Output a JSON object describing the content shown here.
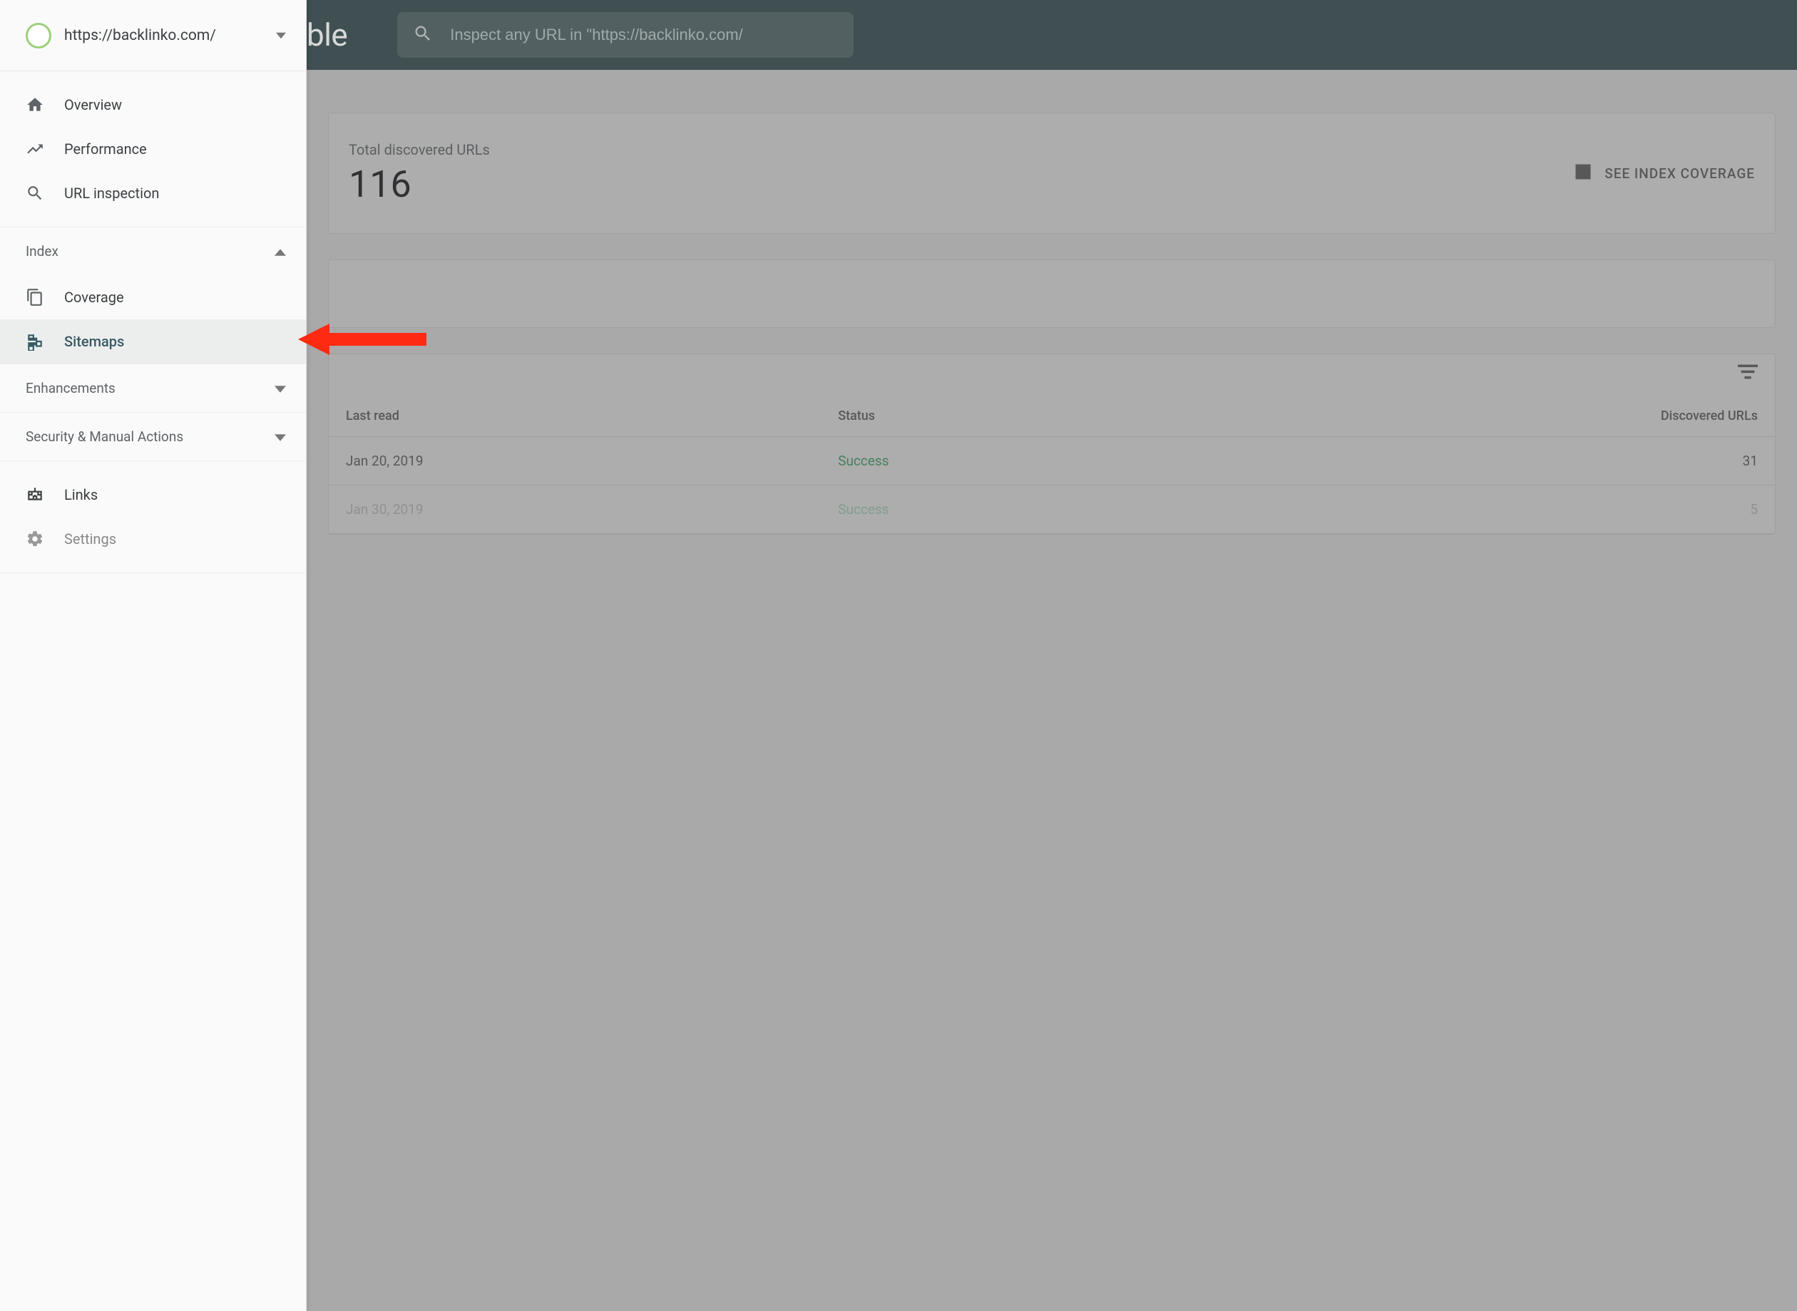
{
  "property": {
    "url": "https://backlinko.com/"
  },
  "topbar": {
    "brand_fragment": "ble",
    "search_placeholder": "Inspect any URL in \"https://backlinko.com/"
  },
  "sidebar": {
    "items": {
      "overview": "Overview",
      "performance": "Performance",
      "url_inspection": "URL inspection",
      "coverage": "Coverage",
      "sitemaps": "Sitemaps",
      "links": "Links",
      "settings": "Settings"
    },
    "groups": {
      "index": "Index",
      "enhancements": "Enhancements",
      "security": "Security & Manual Actions"
    }
  },
  "main": {
    "stat_label": "Total discovered URLs",
    "stat_value": "116",
    "see_coverage": "SEE INDEX COVERAGE",
    "table": {
      "headers": {
        "last_read": "Last read",
        "status": "Status",
        "discovered": "Discovered URLs"
      },
      "rows": [
        {
          "last_read": "Jan 20, 2019",
          "status": "Success",
          "discovered": "31"
        },
        {
          "last_read": "Jan 30, 2019",
          "status": "Success",
          "discovered": "5"
        }
      ]
    }
  }
}
